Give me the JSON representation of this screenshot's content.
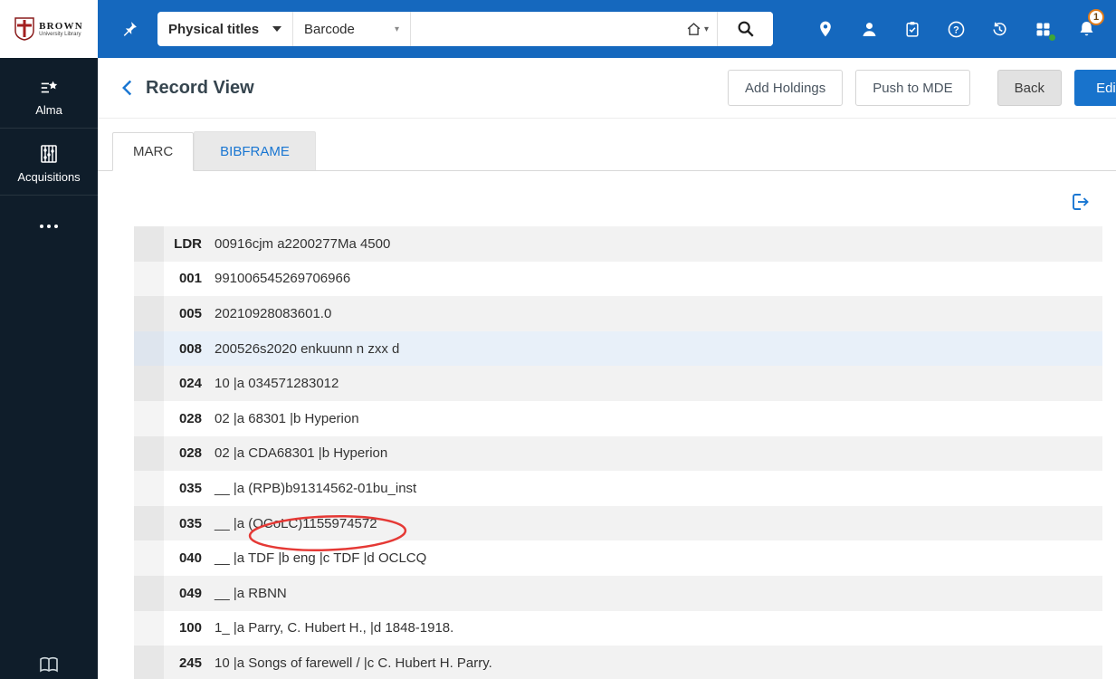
{
  "topbar": {
    "logo_line1": "BROWN",
    "logo_line2": "University Library",
    "scope_label": "Physical titles",
    "index_label": "Barcode",
    "search_value": "",
    "notification_count": "1",
    "icons": [
      "pin-menu-icon",
      "location-icon",
      "user-icon",
      "tasks-clipboard-icon",
      "help-icon",
      "history-icon",
      "apps-grid-icon",
      "notifications-bell-icon",
      "home-icon",
      "search-icon"
    ]
  },
  "sidebar": {
    "items": [
      {
        "label": "Alma",
        "icon": "alma-star-list-icon"
      },
      {
        "label": "Acquisitions",
        "icon": "acquisitions-abacus-icon"
      },
      {
        "label": "",
        "icon": "more-ellipsis-icon"
      }
    ],
    "bottom_icon": "open-book-icon"
  },
  "header": {
    "title": "Record View",
    "add_holdings_label": "Add Holdings",
    "push_to_mde_label": "Push to MDE",
    "back_label": "Back",
    "edit_label": "Edit"
  },
  "tabs": {
    "marc_label": "MARC",
    "bibframe_label": "BIBFRAME",
    "active": "MARC"
  },
  "marc": {
    "rows": [
      {
        "tag": "LDR",
        "content": "00916cjm a2200277Ma 4500"
      },
      {
        "tag": "001",
        "content": "991006545269706966"
      },
      {
        "tag": "005",
        "content": "20210928083601.0"
      },
      {
        "tag": "008",
        "content": "200526s2020 enkuunn n zxx d"
      },
      {
        "tag": "024",
        "content": "10 |a 034571283012"
      },
      {
        "tag": "028",
        "content": "02 |a 68301 |b Hyperion"
      },
      {
        "tag": "028",
        "content": "02 |a CDA68301 |b Hyperion"
      },
      {
        "tag": "035",
        "content": "__ |a (RPB)b91314562-01bu_inst"
      },
      {
        "tag": "035",
        "content": "__ |a (OCoLC)1155974572",
        "annotation": "red-ellipse"
      },
      {
        "tag": "040",
        "content": "__ |a TDF |b eng |c TDF |d OCLCQ"
      },
      {
        "tag": "049",
        "content": "__ |a RBNN"
      },
      {
        "tag": "100",
        "content": "1_ |a Parry, C. Hubert H., |d 1848-1918."
      },
      {
        "tag": "245",
        "content": "10 |a Songs of farewell / |c C. Hubert H. Parry."
      }
    ]
  },
  "colors": {
    "topbar_blue": "#1568BE",
    "sidebar_dark": "#0F1D2A",
    "accent_blue": "#1976D2",
    "edit_button_blue": "#1873CC",
    "annotation_red": "#E53935",
    "badge_orange": "#E07B1A",
    "status_green": "#3FA535",
    "row_gray": "#F2F2F2",
    "row_highlight_blue": "#E8F0F9"
  }
}
